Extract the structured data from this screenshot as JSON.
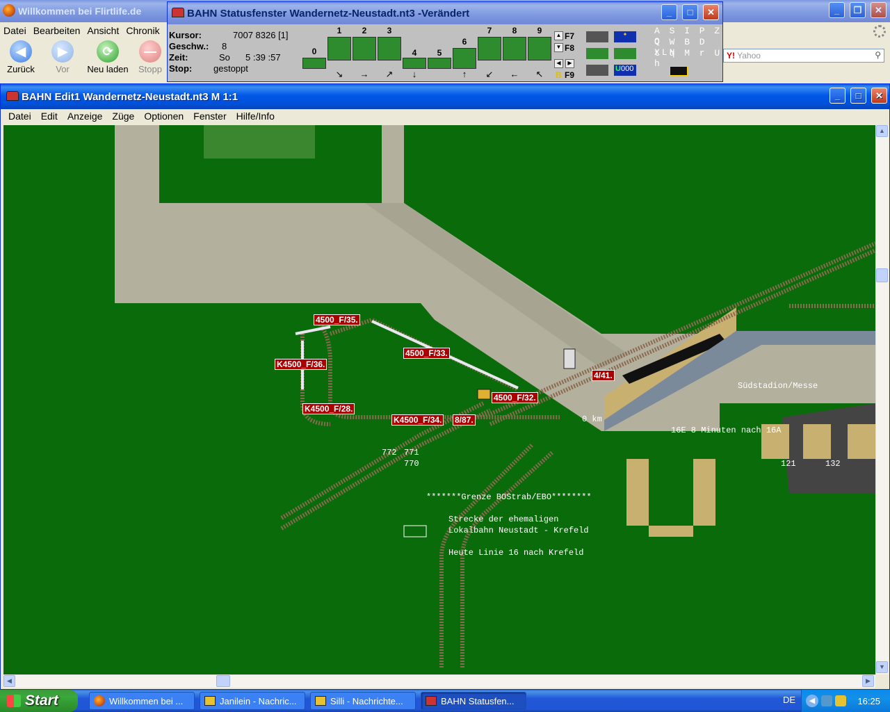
{
  "firefox": {
    "title": "Willkommen bei Flirtlife.de",
    "menu": [
      "Datei",
      "Bearbeiten",
      "Ansicht",
      "Chronik"
    ],
    "nav": {
      "back": "Zurück",
      "forward": "Vor",
      "reload": "Neu laden",
      "stop": "Stopp"
    },
    "search_placeholder": "Yahoo"
  },
  "status_window": {
    "title": "BAHN Statusfenster Wandernetz-Neustadt.nt3 -Verändert",
    "labels": {
      "cursor": "Kursor:",
      "speed": "Geschw.:",
      "time": "Zeit:",
      "stop": "Stop:"
    },
    "values": {
      "cursor": "7007  8326 [1]",
      "speed": "8",
      "time_day": "So",
      "time": "5 :39 :57",
      "stop": "gestoppt"
    },
    "tile_numbers": [
      "0",
      "1",
      "2",
      "3",
      "4",
      "5",
      "6",
      "7",
      "8",
      "9"
    ],
    "tile_arrows": [
      "↘",
      "→",
      "↗",
      "↓",
      "↑",
      "↙",
      "←",
      "↖"
    ],
    "fkeys": [
      "F7",
      "F8",
      "F9"
    ],
    "fkey_b": "B",
    "counter": "000",
    "letters_row1": "A S I P Z Q",
    "letters_row2": "O W B D XLN",
    "letters_row3": "t q M r U h"
  },
  "edit_window": {
    "title": "BAHN Edit1 Wandernetz-Neustadt.nt3 M 1:1",
    "menu": [
      "Datei",
      "Edit",
      "Anzeige",
      "Züge",
      "Optionen",
      "Fenster",
      "Hilfe/Info"
    ]
  },
  "map": {
    "train_labels": [
      "4500_F/35.",
      "4500_F/33.",
      "K4500_F/36.",
      "K4500_F/28.",
      "K4500_F/34.",
      "8/87.",
      "4500_F/32.",
      "4/41."
    ],
    "station": "Südstadion/Messe",
    "km": "0 km",
    "departure": "16E 8 Minuten nach 16A",
    "stop_121": "121",
    "stop_132": "132",
    "track_772": "772",
    "track_771": "771",
    "track_770": "770",
    "border": "*******Grenze BOStrab/EBO********",
    "line1": "Strecke der ehemaligen",
    "line2": "Lokalbahn Neustadt - Krefeld",
    "line3": "Heute Linie 16 nach Krefeld"
  },
  "taskbar": {
    "start": "Start",
    "items": [
      "Willkommen bei ...",
      "Janilein - Nachric...",
      "Silli - Nachrichte...",
      "BAHN Statusfen..."
    ],
    "lang": "DE",
    "clock": "16:25"
  }
}
